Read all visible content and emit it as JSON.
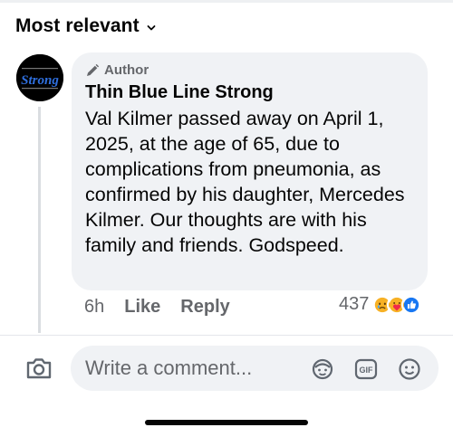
{
  "sort": {
    "label": "Most relevant",
    "icon": "chevron-down-icon"
  },
  "comment": {
    "avatar_text": "Strong",
    "author_badge": "Author",
    "author_badge_icon": "pencil-icon",
    "name": "Thin Blue Line Strong",
    "body": "Val Kilmer passed away on April 1, 2025, at the age of 65, due to complications from pneumonia, as confirmed by his daughter, Mercedes Kilmer. Our thoughts are with his family and friends. Godspeed.",
    "time": "6h",
    "like_label": "Like",
    "reply_label": "Reply",
    "reaction_count": "437",
    "reactions": [
      "sad-reaction-icon",
      "care-reaction-icon",
      "like-reaction-icon"
    ]
  },
  "composer": {
    "placeholder": "Write a comment...",
    "icons": [
      "camera-icon",
      "avatar-sticker-icon",
      "gif-icon",
      "emoji-icon"
    ]
  },
  "colors": {
    "secondary_text": "#65676b",
    "bubble": "#f0f2f5",
    "like_blue": "#1877f2"
  }
}
